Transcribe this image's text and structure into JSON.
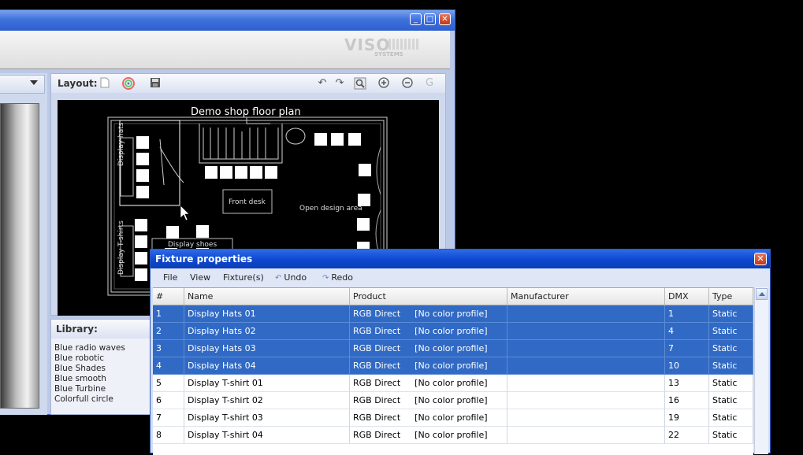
{
  "main_window": {
    "brand_logo": "VISO",
    "brand_logo_sub": "SYSTEMS",
    "layout_panel": {
      "label": "Layout:",
      "floor_plan": {
        "title": "Demo shop floor plan",
        "labels": {
          "display_hats": "Display hats",
          "display_tshirts": "Display T-shirts",
          "display_shoes": "Display shoes",
          "front_desk": "Front desk",
          "open_design_area": "Open design area"
        }
      }
    },
    "library_panel": {
      "label": "Library:",
      "items": [
        "Blue radio waves",
        "Blue robotic",
        "Blue Shades",
        "Blue smooth",
        "Blue Turbine",
        "Colorfull circle"
      ]
    }
  },
  "fixture_dialog": {
    "title": "Fixture properties",
    "menu": [
      "File",
      "View",
      "Fixture(s)",
      "Undo",
      "Redo"
    ],
    "columns": [
      "#",
      "Name",
      "Product",
      "Manufacturer",
      "DMX",
      "Type"
    ],
    "rows": [
      {
        "num": "1",
        "name": "Display Hats 01",
        "product": "RGB Direct",
        "profile": "[No color profile]",
        "manufacturer": "",
        "dmx": "1",
        "type": "Static",
        "selected": true
      },
      {
        "num": "2",
        "name": "Display Hats 02",
        "product": "RGB Direct",
        "profile": "[No color profile]",
        "manufacturer": "",
        "dmx": "4",
        "type": "Static",
        "selected": true
      },
      {
        "num": "3",
        "name": "Display Hats 03",
        "product": "RGB Direct",
        "profile": "[No color profile]",
        "manufacturer": "",
        "dmx": "7",
        "type": "Static",
        "selected": true
      },
      {
        "num": "4",
        "name": "Display Hats 04",
        "product": "RGB Direct",
        "profile": "[No color profile]",
        "manufacturer": "",
        "dmx": "10",
        "type": "Static",
        "selected": true
      },
      {
        "num": "5",
        "name": "Display T-shirt 01",
        "product": "RGB Direct",
        "profile": "[No color profile]",
        "manufacturer": "",
        "dmx": "13",
        "type": "Static",
        "selected": false
      },
      {
        "num": "6",
        "name": "Display T-shirt 02",
        "product": "RGB Direct",
        "profile": "[No color profile]",
        "manufacturer": "",
        "dmx": "16",
        "type": "Static",
        "selected": false
      },
      {
        "num": "7",
        "name": "Display T-shirt 03",
        "product": "RGB Direct",
        "profile": "[No color profile]",
        "manufacturer": "",
        "dmx": "19",
        "type": "Static",
        "selected": false
      },
      {
        "num": "8",
        "name": "Display T-shirt 04",
        "product": "RGB Direct",
        "profile": "[No color profile]",
        "manufacturer": "",
        "dmx": "22",
        "type": "Static",
        "selected": false
      }
    ]
  },
  "colors": {
    "selection": "#316ac5",
    "dialog_title": "#0f4ad0",
    "canvas": "#000000"
  }
}
